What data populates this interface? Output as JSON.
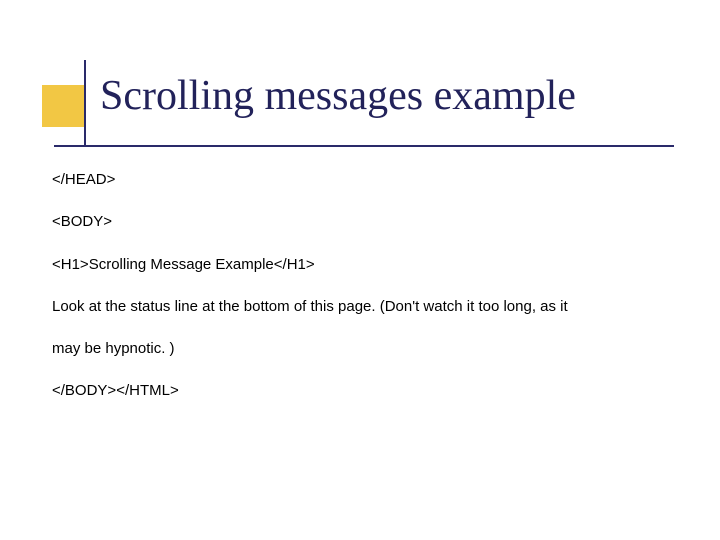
{
  "title": "Scrolling messages example",
  "lines": {
    "l1": "</HEAD>",
    "l2": "<BODY>",
    "l3": "<H1>Scrolling Message Example</H1>",
    "l4": "Look at the status line at the bottom of this page. (Don't watch it too long, as it",
    "l5": "may be hypnotic. )",
    "l6": "</BODY></HTML>"
  }
}
